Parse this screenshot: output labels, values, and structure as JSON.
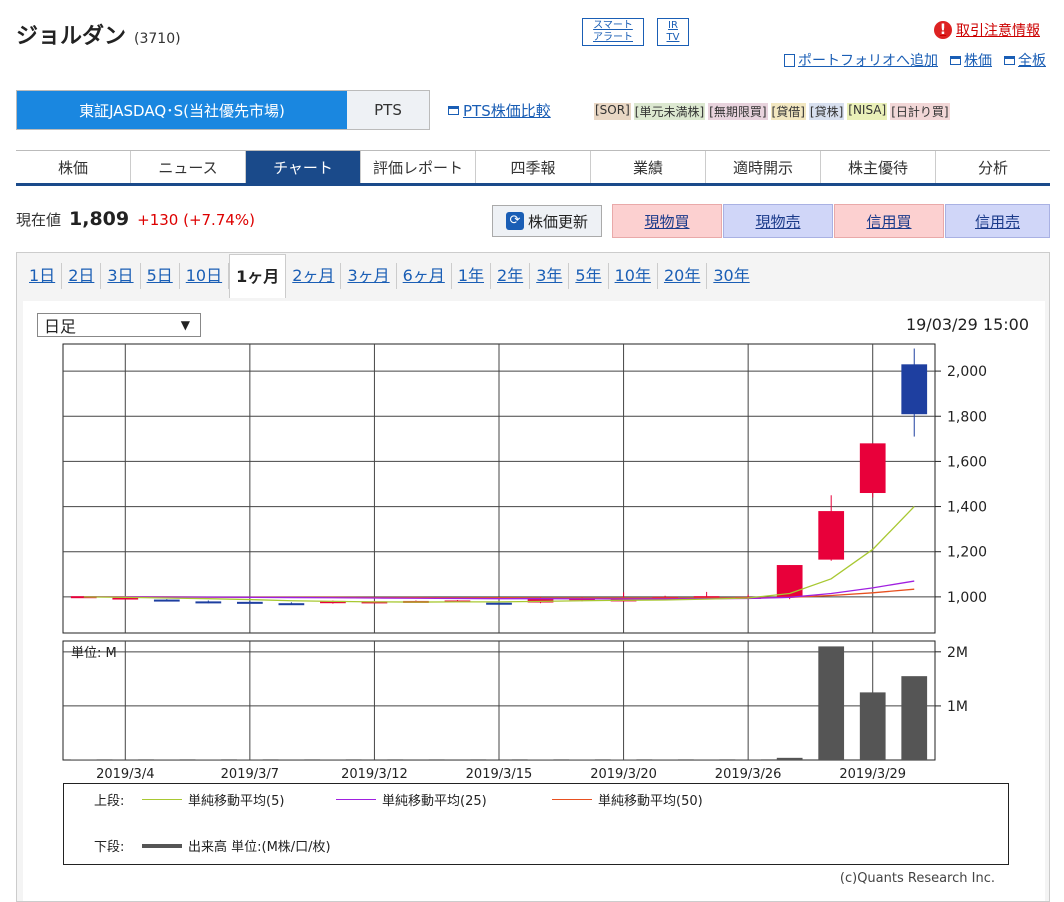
{
  "header": {
    "name": "ジョルダン",
    "code": "(3710)",
    "smart_alert": [
      "スマート",
      "アラート"
    ],
    "irtv": [
      "IR",
      "TV"
    ],
    "warning": "取引注意情報",
    "links": [
      "ポートフォリオへ追加",
      "株価",
      "全板"
    ]
  },
  "market": {
    "primary": "東証JASDAQ･S(当社優先市場)",
    "pts": "PTS",
    "pts_compare": "PTS株価比較",
    "badges": [
      {
        "t": "[SOR]",
        "c": "#e9d7c4"
      },
      {
        "t": "[単元未満株]",
        "c": "#dce8d0"
      },
      {
        "t": "[無期限買]",
        "c": "#e8d3dd"
      },
      {
        "t": "[貸借]",
        "c": "#f2e7c0"
      },
      {
        "t": "[貸株]",
        "c": "#d8e0ef"
      },
      {
        "t": "[NISA]",
        "c": "#eaf0b8"
      },
      {
        "t": "[日計り買]",
        "c": "#f2d7d7"
      }
    ]
  },
  "nav": [
    "株価",
    "ニュース",
    "チャート",
    "評価レポート",
    "四季報",
    "業績",
    "適時開示",
    "株主優待",
    "分析"
  ],
  "nav_active": 2,
  "price": {
    "label": "現在値",
    "value": "1,809",
    "change": "+130 (+7.74%)"
  },
  "buttons": {
    "refresh": "株価更新",
    "spot_buy": "現物買",
    "spot_sell": "現物売",
    "margin_buy": "信用買",
    "margin_sell": "信用売"
  },
  "periods": [
    "1日",
    "2日",
    "3日",
    "5日",
    "10日",
    "1ヶ月",
    "2ヶ月",
    "3ヶ月",
    "6ヶ月",
    "1年",
    "2年",
    "3年",
    "5年",
    "10年",
    "20年",
    "30年"
  ],
  "period_active": 5,
  "chart_select": "日足",
  "chart_datetime": "19/03/29 15:00",
  "vol_unit": "単位: M",
  "legend": {
    "upper": "上段:",
    "lower": "下段:",
    "ma5": "単純移動平均(5)",
    "ma25": "単純移動平均(25)",
    "ma50": "単純移動平均(50)",
    "volume": "出来高 単位:(M株/口/枚)",
    "ma5_color": "#a8c832",
    "ma25_color": "#a020e0",
    "ma50_color": "#e85020",
    "vol_color": "#555555"
  },
  "copyright": "(c)Quants Research Inc.",
  "chart_data": {
    "type": "candlestick",
    "x_labels": [
      "2019/3/4",
      "2019/3/7",
      "2019/3/12",
      "2019/3/15",
      "2019/3/20",
      "2019/3/26",
      "2019/3/29"
    ],
    "y_ticks": [
      "1,000",
      "1,200",
      "1,400",
      "1,600",
      "1,800",
      "2,000"
    ],
    "y_range": [
      840,
      2120
    ],
    "vol_ticks": [
      "1M",
      "2M"
    ],
    "vol_range": [
      0,
      2200000
    ],
    "candles": [
      {
        "o": 1002,
        "h": 1004,
        "l": 1000,
        "c": 1003,
        "v": 6000
      },
      {
        "o": 996,
        "h": 1000,
        "l": 994,
        "c": 997,
        "v": 5000
      },
      {
        "o": 988,
        "h": 990,
        "l": 980,
        "c": 982,
        "v": 6000
      },
      {
        "o": 980,
        "h": 984,
        "l": 972,
        "c": 975,
        "v": 7000
      },
      {
        "o": 978,
        "h": 982,
        "l": 970,
        "c": 973,
        "v": 7000
      },
      {
        "o": 972,
        "h": 976,
        "l": 966,
        "c": 970,
        "v": 5000
      },
      {
        "o": 972,
        "h": 984,
        "l": 970,
        "c": 982,
        "v": 6000
      },
      {
        "o": 978,
        "h": 982,
        "l": 974,
        "c": 980,
        "v": 4000
      },
      {
        "o": 980,
        "h": 984,
        "l": 976,
        "c": 982,
        "v": 4000
      },
      {
        "o": 982,
        "h": 986,
        "l": 978,
        "c": 984,
        "v": 4000
      },
      {
        "o": 974,
        "h": 978,
        "l": 966,
        "c": 968,
        "v": 5000
      },
      {
        "o": 975,
        "h": 1000,
        "l": 972,
        "c": 995,
        "v": 8000
      },
      {
        "o": 985,
        "h": 1000,
        "l": 980,
        "c": 996,
        "v": 7000
      },
      {
        "o": 980,
        "h": 1020,
        "l": 978,
        "c": 995,
        "v": 9000
      },
      {
        "o": 992,
        "h": 1005,
        "l": 985,
        "c": 1000,
        "v": 6000
      },
      {
        "o": 1000,
        "h": 1022,
        "l": 995,
        "c": 1003,
        "v": 6000
      },
      {
        "o": 1000,
        "h": 1010,
        "l": 990,
        "c": 1000,
        "v": 6000
      },
      {
        "o": 998,
        "h": 1141,
        "l": 990,
        "c": 1141,
        "v": 40000
      },
      {
        "o": 1165,
        "h": 1450,
        "l": 1160,
        "c": 1380,
        "v": 2100000
      },
      {
        "o": 1460,
        "h": 1680,
        "l": 1440,
        "c": 1680,
        "v": 1250000
      },
      {
        "o": 2030,
        "h": 2100,
        "l": 1710,
        "c": 1809,
        "v": 1550000
      }
    ],
    "ma5": [
      1000,
      998,
      995,
      992,
      988,
      983,
      980,
      978,
      977,
      978,
      978,
      980,
      983,
      985,
      986,
      990,
      995,
      1015,
      1080,
      1210,
      1400
    ],
    "ma25": [
      1000,
      1000,
      999,
      999,
      998,
      997,
      996,
      995,
      994,
      993,
      992,
      992,
      991,
      991,
      991,
      992,
      993,
      998,
      1015,
      1040,
      1070
    ],
    "ma50": [
      1000,
      1000,
      1000,
      999,
      999,
      998,
      998,
      997,
      997,
      996,
      996,
      995,
      995,
      995,
      995,
      995,
      996,
      998,
      1006,
      1018,
      1034
    ]
  }
}
